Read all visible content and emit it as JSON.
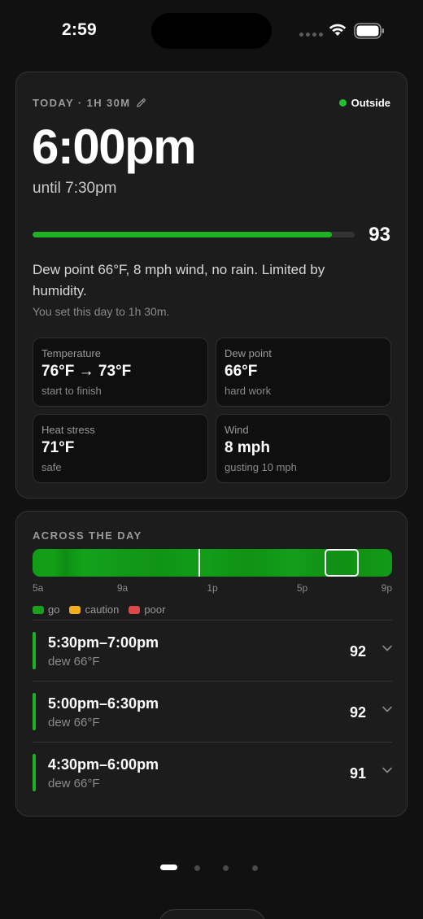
{
  "status_bar": {
    "time": "2:59",
    "icons": [
      "signal-dots-icon",
      "wifi-icon",
      "battery-icon"
    ]
  },
  "today": {
    "meta": "TODAY · 1H 30M",
    "edit_icon": "pencil-icon",
    "location_label": "Outside",
    "start_time": "6:00pm",
    "until": "until 7:30pm",
    "score": "93",
    "score_fraction": 0.93,
    "summary": "Dew point 66°F, 8 mph wind, no rain. Limited by humidity.",
    "note": "You set this day to 1h 30m.",
    "stats": [
      {
        "label": "Temperature",
        "value": "76°F → 73°F",
        "sub": "start to finish"
      },
      {
        "label": "Dew point",
        "value": "66°F",
        "sub": "hard work"
      },
      {
        "label": "Heat stress",
        "value": "71°F",
        "sub": "safe"
      },
      {
        "label": "Wind",
        "value": "8 mph",
        "sub": "gusting 10 mph"
      }
    ]
  },
  "day": {
    "title": "ACROSS THE DAY",
    "axis_ticks": [
      "5a",
      "9a",
      "1p",
      "5p",
      "9p"
    ],
    "now_marker_hour": 12.4,
    "selected_window_hours": [
      18.0,
      19.5
    ],
    "axis_range_hours": [
      5,
      21
    ],
    "legend": [
      {
        "label": "go",
        "color": "#1aa01e"
      },
      {
        "label": "caution",
        "color": "#f0b020"
      },
      {
        "label": "poor",
        "color": "#d9484a"
      }
    ],
    "windows": [
      {
        "time": "5:30pm–7:00pm",
        "dew": "dew 66°F",
        "score": "92"
      },
      {
        "time": "5:00pm–6:30pm",
        "dew": "dew 66°F",
        "score": "92"
      },
      {
        "time": "4:30pm–6:00pm",
        "dew": "dew 66°F",
        "score": "91"
      }
    ]
  },
  "pager": {
    "count": 4,
    "active_index": 0
  },
  "colors": {
    "accent": "#1fb024",
    "background": "#111111",
    "card": "#1c1c1c"
  }
}
